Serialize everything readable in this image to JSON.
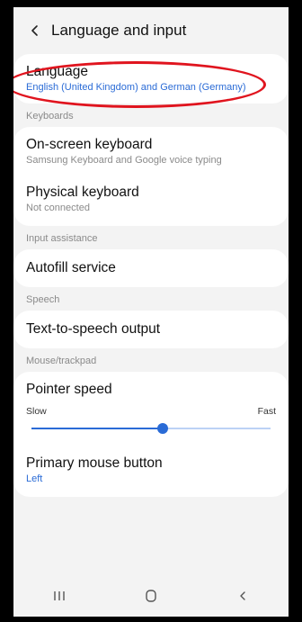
{
  "header": {
    "title": "Language and input"
  },
  "language": {
    "title": "Language",
    "value": "English (United Kingdom) and German (Germany)"
  },
  "sections": {
    "keyboards": "Keyboards",
    "input_assistance": "Input assistance",
    "speech": "Speech",
    "mouse": "Mouse/trackpad"
  },
  "onscreen_keyboard": {
    "title": "On-screen keyboard",
    "sub": "Samsung Keyboard and Google voice typing"
  },
  "physical_keyboard": {
    "title": "Physical keyboard",
    "sub": "Not connected"
  },
  "autofill": {
    "title": "Autofill service"
  },
  "tts": {
    "title": "Text-to-speech output"
  },
  "pointer_speed": {
    "title": "Pointer speed",
    "min_label": "Slow",
    "max_label": "Fast",
    "value_fraction": 0.55
  },
  "primary_mouse": {
    "title": "Primary mouse button",
    "value": "Left"
  },
  "colors": {
    "accent": "#2a6bd6",
    "annotation": "#e0141e",
    "background": "#f3f3f3"
  },
  "icons": {
    "back": "chevron-left-icon",
    "recents": "recents-icon",
    "home": "home-icon",
    "nav_back": "back-icon"
  }
}
